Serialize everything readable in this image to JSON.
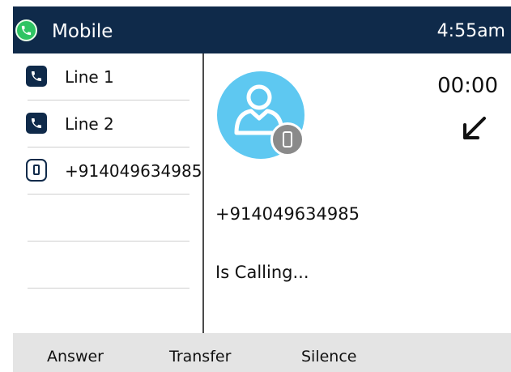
{
  "header": {
    "title": "Mobile",
    "time": "4:55am"
  },
  "lines": [
    {
      "label": "Line 1",
      "icon": "phone-icon"
    },
    {
      "label": "Line 2",
      "icon": "phone-icon"
    },
    {
      "label": "+914049634985",
      "icon": "mobile-phone-icon"
    }
  ],
  "call": {
    "timer": "00:00",
    "direction_icon": "incoming-call-arrow-icon",
    "number": "+914049634985",
    "status": "Is Calling..."
  },
  "softkeys": {
    "answer": "Answer",
    "transfer": "Transfer",
    "silence": "Silence"
  },
  "colors": {
    "header_bg": "#0f2a4a",
    "avatar": "#5ec8f1",
    "app_icon": "#2fc463",
    "softkey_bar": "#e4e4e4"
  }
}
